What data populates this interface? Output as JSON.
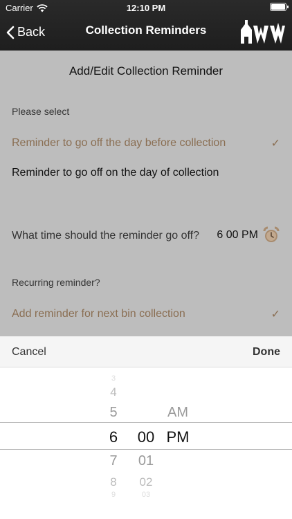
{
  "status_bar": {
    "carrier": "Carrier",
    "time": "12:10 PM"
  },
  "nav": {
    "back_label": "Back",
    "title": "Collection Reminders"
  },
  "page": {
    "title": "Add/Edit Collection Reminder",
    "please_select": "Please select",
    "option_day_before": "Reminder to go off the day before collection",
    "option_day_of": "Reminder to go off on the day of collection",
    "time_question": "What time should the reminder go off?",
    "time_value": "6 00 PM",
    "recurring_label": "Recurring reminder?",
    "option_next_bin": "Add reminder for next bin collection"
  },
  "toolbar": {
    "cancel": "Cancel",
    "done": "Done"
  },
  "picker": {
    "hours": [
      "3",
      "4",
      "5",
      "6",
      "7",
      "8",
      "9"
    ],
    "minutes": [
      "00",
      "01",
      "02",
      "03"
    ],
    "ampm": [
      "AM",
      "PM"
    ],
    "selected": {
      "hour": "6",
      "minute": "00",
      "ampm": "PM"
    }
  },
  "colors": {
    "accent": "#8a6e52",
    "nav_bg": "#222222",
    "dim_bg": "#bdbdbd"
  }
}
